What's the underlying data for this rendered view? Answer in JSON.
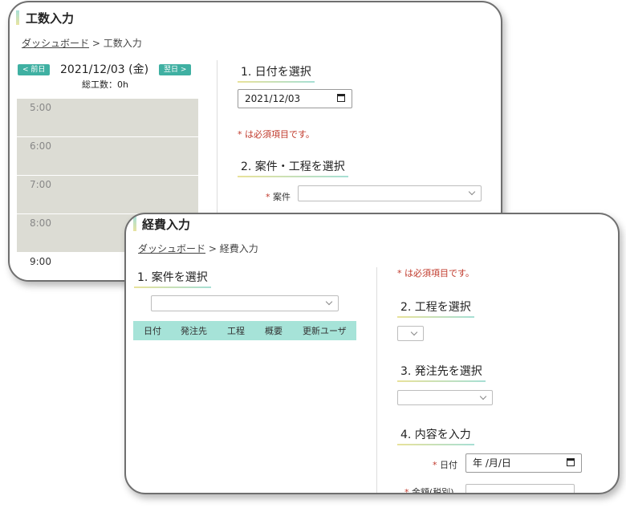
{
  "win1": {
    "title": "工数入力",
    "breadcrumb": {
      "link": "ダッシュボード",
      "sep": " > ",
      "current": "工数入力"
    },
    "prev_btn": "< 前日",
    "next_btn": "翌日 >",
    "current_date": "2021/12/03 (金)",
    "total_hours": "総工数：0h",
    "time_slots": [
      "5:00",
      "6:00",
      "7:00",
      "8:00",
      "9:00"
    ],
    "step1": "1. 日付を選択",
    "date_value": "2021/12/03",
    "required_note": "* は必須項目です。",
    "step2": "2. 案件・工程を選択",
    "project_label": "案件",
    "project_asterisk": "*"
  },
  "win2": {
    "title": "経費入力",
    "breadcrumb": {
      "link": "ダッシュボード",
      "sep": " > ",
      "current": "経費入力"
    },
    "step1": "1. 案件を選択",
    "table_headers": [
      "日付",
      "発注先",
      "工程",
      "概要",
      "更新ユーザ"
    ],
    "required_note": "* は必須項目です。",
    "step2": "2. 工程を選択",
    "step3": "3. 発注先を選択",
    "step4": "4. 内容を入力",
    "date_label": "日付",
    "date_asterisk": "*",
    "date_placeholder": "年 /月/日",
    "amount_label": "金額(税別)",
    "amount_asterisk": "*"
  },
  "colors": {
    "accent": "#3fb0a2",
    "table_header": "#a6e3d8",
    "slot_bg": "#dcdcd4",
    "required": "#c0392b"
  }
}
